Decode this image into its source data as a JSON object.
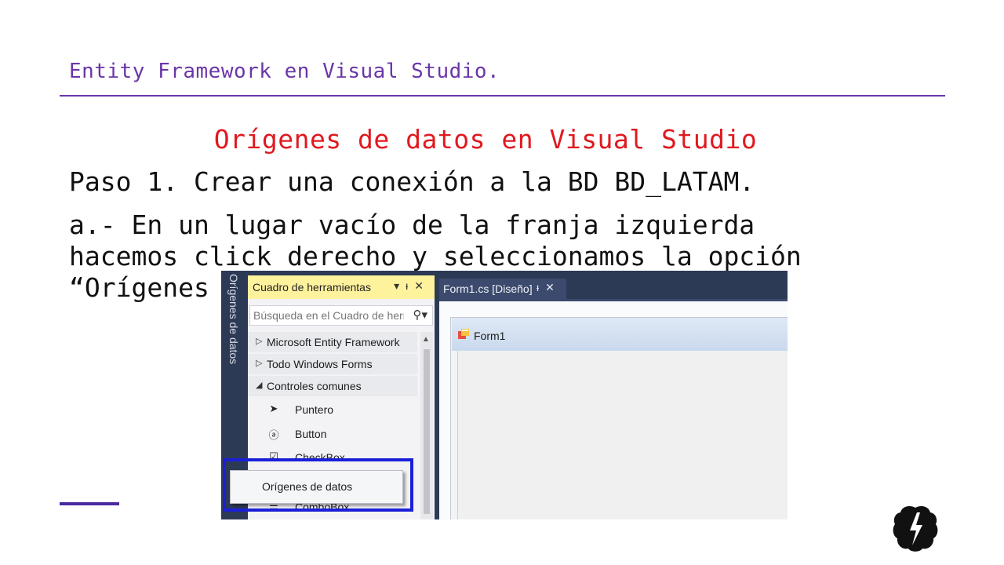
{
  "slide": {
    "header": "Entity Framework en Visual Studio.",
    "subtitle": "Orígenes de datos en Visual Studio",
    "step": "Paso 1. Crear una conexión a la BD BD_LATAM.",
    "paragraph": "a.- En un lugar vacío de la franja izquierda\nhacemos click derecho y seleccionamos la opción\n“Orígenes",
    "colors": {
      "header": "#6a36a8",
      "subtitle": "#e0191f",
      "accent": "#4b2aa0",
      "highlight": "#1b1fd8"
    }
  },
  "vs": {
    "sidebar_tab": "Orígenes de datos",
    "toolbox": {
      "title": "Cuadro de herramientas",
      "title_icons": [
        "chevron-down-icon",
        "pin-icon",
        "close-icon"
      ],
      "search_placeholder": "Búsqueda en el Cuadro de herra",
      "groups": [
        {
          "label": "Microsoft Entity Framework",
          "state": "collapsed"
        },
        {
          "label": "Todo Windows Forms",
          "state": "collapsed"
        },
        {
          "label": "Controles comunes",
          "state": "expanded"
        }
      ],
      "items": [
        {
          "label": "Puntero",
          "icon": "pointer-icon"
        },
        {
          "label": "Button",
          "icon": "button-icon"
        },
        {
          "label": "CheckBox",
          "icon": "checkbox-icon"
        },
        {
          "label": "ComboBox",
          "icon": "combobox-icon"
        }
      ]
    },
    "context_menu": {
      "item": "Orígenes de datos"
    },
    "document": {
      "tab_label": "Form1.cs [Diseño]",
      "form_title": "Form1"
    }
  }
}
